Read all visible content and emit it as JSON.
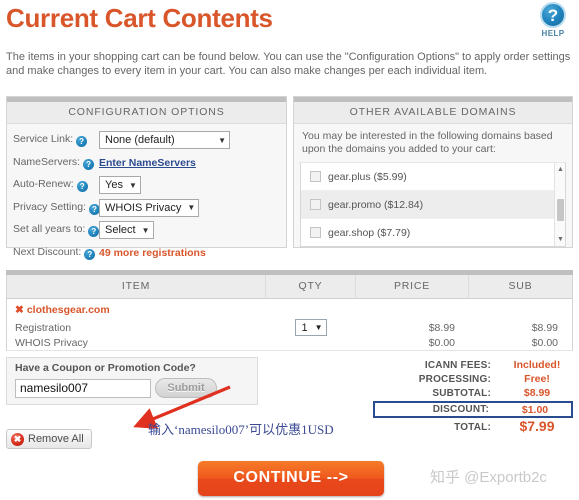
{
  "header": {
    "title": "Current Cart Contents",
    "help_icon": "question-mark-icon",
    "help_label": "HELP"
  },
  "intro": "The items in your shopping cart can be found below. You can use the \"Configuration Options\" to apply order settings and make changes to every item in your cart. You can also make changes per each individual item.",
  "config_panel": {
    "heading": "CONFIGURATION OPTIONS",
    "rows": [
      {
        "label": "Service Link:",
        "type": "select",
        "value": "None (default)"
      },
      {
        "label": "NameServers:",
        "type": "link",
        "value": "Enter NameServers"
      },
      {
        "label": "Auto-Renew:",
        "type": "select",
        "value": "Yes"
      },
      {
        "label": "Privacy Setting:",
        "type": "select",
        "value": "WHOIS Privacy"
      },
      {
        "label": "Set all years to:",
        "type": "select",
        "value": "Select"
      },
      {
        "label": "Next Discount:",
        "type": "note",
        "value": "49 more registrations"
      }
    ]
  },
  "domains_panel": {
    "heading": "OTHER AVAILABLE DOMAINS",
    "intro": "You may be interested in the following domains based upon the domains you added to your cart:",
    "items": [
      {
        "name": "gear.plus ($5.99)",
        "checked": false
      },
      {
        "name": "gear.promo ($12.84)",
        "checked": false
      },
      {
        "name": "gear.shop ($7.79)",
        "checked": false
      }
    ]
  },
  "items_table": {
    "columns": [
      "ITEM",
      "QTY",
      "PRICE",
      "SUB"
    ],
    "domain": "clothesgear.com",
    "rows": [
      {
        "item": "Registration",
        "qty": "1",
        "price": "$8.99",
        "sub": "$8.99"
      },
      {
        "item": "WHOIS Privacy",
        "qty": "",
        "price": "$0.00",
        "sub": "$0.00"
      }
    ]
  },
  "coupon": {
    "title": "Have a Coupon or Promotion Code?",
    "value": "namesilo007",
    "placeholder": "",
    "submit_label": "Submit"
  },
  "remove_all": {
    "label": "Remove All",
    "icon": "remove-circle-icon"
  },
  "totals": [
    {
      "label": "ICANN FEES:",
      "value": "Included!",
      "highlight": false
    },
    {
      "label": "PROCESSING:",
      "value": "Free!",
      "highlight": false
    },
    {
      "label": "SUBTOTAL:",
      "value": "$8.99",
      "highlight": false
    },
    {
      "label": "DISCOUNT:",
      "value": "$1.00",
      "highlight": true
    },
    {
      "label": "TOTAL:",
      "value": "$7.99",
      "highlight": false
    }
  ],
  "annotation": {
    "text": "输入‘namesilo007’可以优惠1USD",
    "arrow": "red-arrow-icon"
  },
  "continue_button": {
    "label": "CONTINUE -->"
  },
  "watermark": {
    "text": "知乎 @Exportb2c"
  },
  "colors": {
    "brand_orange": "#d9562b",
    "accent_blue": "#2b4b8f",
    "panel_head_bg": "#ececec",
    "panel_bar": "#bfbfbf",
    "button_orange": "#f05a1e"
  }
}
